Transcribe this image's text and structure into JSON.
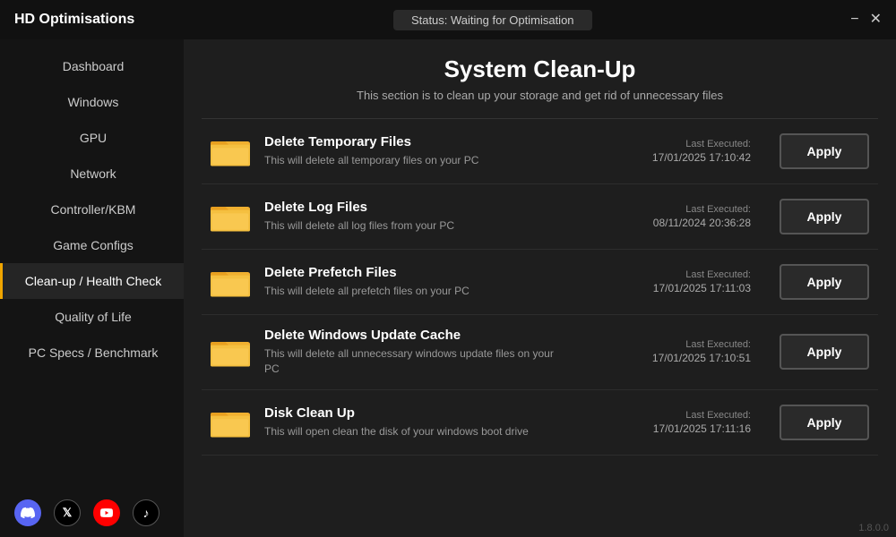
{
  "titleBar": {
    "appName": "HD Optimisations",
    "status": "Status: Waiting for Optimisation",
    "minimizeBtn": "−",
    "closeBtn": "✕"
  },
  "sidebar": {
    "items": [
      {
        "id": "dashboard",
        "label": "Dashboard",
        "active": false
      },
      {
        "id": "windows",
        "label": "Windows",
        "active": false
      },
      {
        "id": "gpu",
        "label": "GPU",
        "active": false
      },
      {
        "id": "network",
        "label": "Network",
        "active": false
      },
      {
        "id": "controller-kbm",
        "label": "Controller/KBM",
        "active": false
      },
      {
        "id": "game-configs",
        "label": "Game Configs",
        "active": false
      },
      {
        "id": "cleanup-health",
        "label": "Clean-up / Health Check",
        "active": true
      },
      {
        "id": "quality-of-life",
        "label": "Quality of Life",
        "active": false
      },
      {
        "id": "pc-specs",
        "label": "PC Specs / Benchmark",
        "active": false
      }
    ],
    "socials": [
      {
        "id": "discord",
        "label": "D"
      },
      {
        "id": "x",
        "label": "𝕏"
      },
      {
        "id": "youtube",
        "label": "▶"
      },
      {
        "id": "tiktok",
        "label": "♪"
      }
    ]
  },
  "main": {
    "title": "System Clean-Up",
    "subtitle": "This section is to clean up your storage and get rid of unnecessary files",
    "items": [
      {
        "id": "delete-temp",
        "title": "Delete Temporary Files",
        "desc": "This will delete all temporary files on your PC",
        "lastExecLabel": "Last Executed:",
        "lastExecDate": "17/01/2025 17:10:42",
        "applyLabel": "Apply"
      },
      {
        "id": "delete-log",
        "title": "Delete Log Files",
        "desc": "This will delete all log files from your PC",
        "lastExecLabel": "Last Executed:",
        "lastExecDate": "08/11/2024 20:36:28",
        "applyLabel": "Apply"
      },
      {
        "id": "delete-prefetch",
        "title": "Delete Prefetch Files",
        "desc": "This will delete all prefetch files on your PC",
        "lastExecLabel": "Last Executed:",
        "lastExecDate": "17/01/2025 17:11:03",
        "applyLabel": "Apply"
      },
      {
        "id": "delete-windows-update",
        "title": "Delete Windows Update Cache",
        "desc": "This will delete all unnecessary windows update files on your PC",
        "lastExecLabel": "Last Executed:",
        "lastExecDate": "17/01/2025 17:10:51",
        "applyLabel": "Apply"
      },
      {
        "id": "disk-cleanup",
        "title": "Disk Clean Up",
        "desc": "This will open clean the disk of your windows boot drive",
        "lastExecLabel": "Last Executed:",
        "lastExecDate": "17/01/2025 17:11:16",
        "applyLabel": "Apply"
      }
    ]
  },
  "version": "1.8.0.0"
}
